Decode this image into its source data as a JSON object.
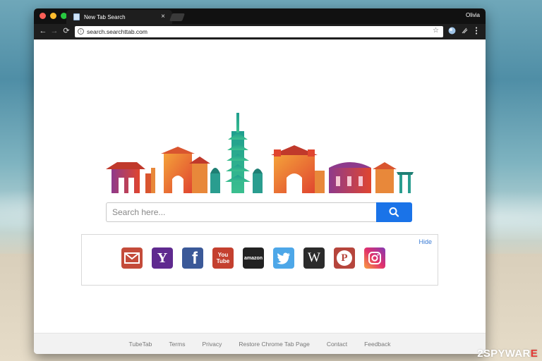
{
  "window": {
    "tab_title": "New Tab Search",
    "tab_close": "×",
    "user_name": "Olivia"
  },
  "toolbar": {
    "back": "←",
    "forward": "→",
    "reload": "⟳",
    "url": "search.searchttab.com",
    "bookmark_star": "☆",
    "info": "i"
  },
  "search": {
    "placeholder": "Search here..."
  },
  "shortcuts": {
    "hide_label": "Hide",
    "items": [
      {
        "name": "mail",
        "icon": "envelope-icon",
        "color": "#c44b3a"
      },
      {
        "name": "yahoo",
        "icon": "yahoo-icon",
        "color": "#5f2a8f",
        "glyph": "Y"
      },
      {
        "name": "facebook",
        "icon": "facebook-icon",
        "color": "#3b5998",
        "glyph": "f"
      },
      {
        "name": "youtube",
        "icon": "youtube-icon",
        "color": "#c4402f",
        "glyph": "You Tube"
      },
      {
        "name": "amazon",
        "icon": "amazon-icon",
        "color": "#222222",
        "glyph": "amazon"
      },
      {
        "name": "twitter",
        "icon": "twitter-icon",
        "color": "#4da7e8"
      },
      {
        "name": "wikipedia",
        "icon": "wikipedia-icon",
        "color": "#2b2b2b",
        "glyph": "W"
      },
      {
        "name": "pinterest",
        "icon": "pinterest-icon",
        "color": "#b6453c",
        "glyph": "P"
      },
      {
        "name": "instagram",
        "icon": "instagram-icon",
        "color": "#c13584"
      }
    ]
  },
  "footer": {
    "links": [
      "TubeTab",
      "Terms",
      "Privacy",
      "Restore Chrome Tab Page",
      "Contact",
      "Feedback"
    ]
  },
  "colors": {
    "accent": "#1a73e8",
    "chrome_dark": "#1e1e1e"
  },
  "watermark": {
    "prefix": "2SPYWAR",
    "suffix": "E"
  }
}
